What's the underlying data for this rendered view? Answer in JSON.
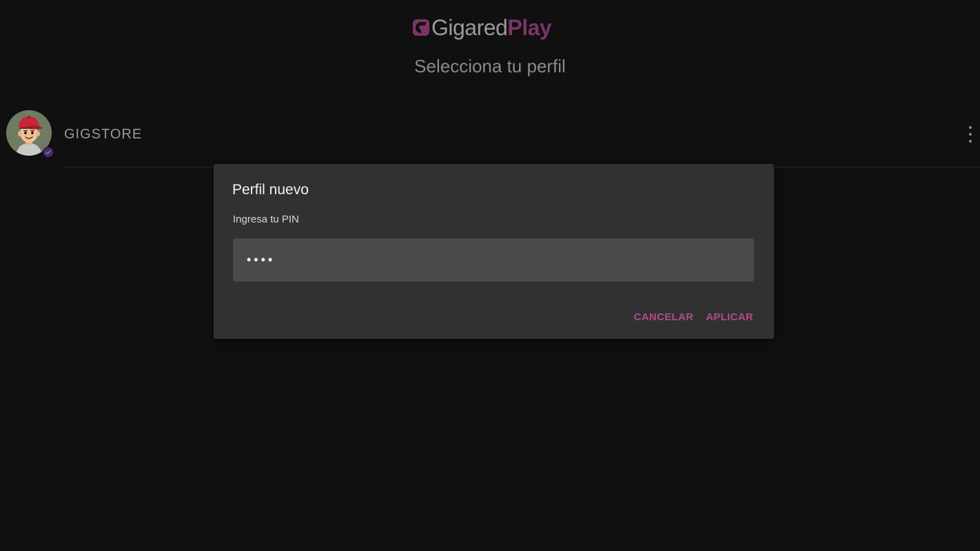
{
  "brand": {
    "name_part1": "Gigared",
    "name_part2": "Play",
    "accent_color": "#7c3466",
    "logo_icon": "gigared-logo-mark"
  },
  "page": {
    "title": "Selecciona tu perfil"
  },
  "profiles": [
    {
      "name": "GIGSTORE",
      "avatar": "cartoon-boy-red-cap-avatar",
      "badge_icon": "check-badge-icon",
      "badge_color": "#4a2a6e"
    }
  ],
  "profile_menu_icon": "more-vertical-icon",
  "dialog": {
    "title": "Perfil nuevo",
    "label": "Ingresa tu PIN",
    "pin_value": "••••",
    "cancel_label": "CANCELAR",
    "apply_label": "APLICAR",
    "button_color": "#b04a8e"
  }
}
